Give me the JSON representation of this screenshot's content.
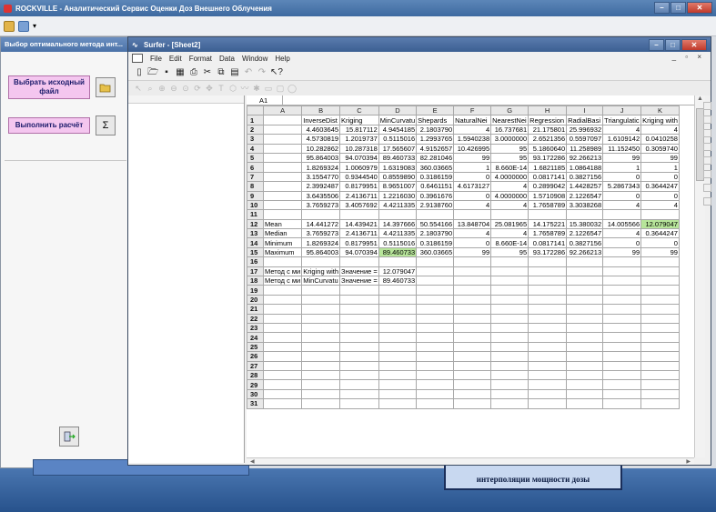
{
  "app": {
    "title": "ROCKVILLE - Аналитический Сервис Оценки Доз Внешнего Облучения"
  },
  "left_panel": {
    "title": "Выбор оптимального метода инт...",
    "select_file_label": "Выбрать исходный файл",
    "run_calc_label": "Выполнить расчёт",
    "run_calc_icon_glyph": "Σ",
    "icons": [
      "folder-open-icon",
      "sigma-icon",
      "exit-icon"
    ]
  },
  "surfer": {
    "title": "Surfer - [Sheet2]",
    "menu": [
      "File",
      "Edit",
      "Format",
      "Data",
      "Window",
      "Help"
    ],
    "cell_ref": "A1"
  },
  "bottom": {
    "dose_card_text": "интерполяции мощности дозы"
  },
  "sheet": {
    "columns": [
      "A",
      "B",
      "C",
      "D",
      "E",
      "F",
      "G",
      "H",
      "I",
      "J",
      "K"
    ],
    "rows": [
      [
        "1",
        "",
        "InverseDist",
        "Kriging",
        "MinCurvatu",
        "Shepards",
        "NaturalNei",
        "NearestNei",
        "Regression",
        "RadialBasi",
        "Triangulatic",
        "Kriging with"
      ],
      [
        "2",
        "",
        "4.4603645",
        "15.817112",
        "4.9454185",
        "2.1803790",
        "4",
        "16.737681",
        "21.175801",
        "25.996932",
        "4",
        "4"
      ],
      [
        "3",
        "",
        "4.5730819",
        "1.2019737",
        "0.5115016",
        "1.2993765",
        "1.5940238",
        "3.0000000",
        "2.6521356",
        "0.5597097",
        "1.6109142",
        "0.0410258"
      ],
      [
        "4",
        "",
        "10.282862",
        "10.287318",
        "17.565607",
        "4.9152657",
        "10.426995",
        "95",
        "5.1860640",
        "11.258989",
        "11.152450",
        "0.3059740"
      ],
      [
        "5",
        "",
        "95.864003",
        "94.070394",
        "89.460733",
        "82.281046",
        "99",
        "95",
        "93.172286",
        "92.266213",
        "99",
        "99"
      ],
      [
        "6",
        "",
        "1.8269324",
        "1.0060979",
        "1.6319083",
        "360.03665",
        "1",
        "8.660E-14",
        "1.6821185",
        "1.0864188",
        "1",
        "1"
      ],
      [
        "7",
        "",
        "3.1554770",
        "0.9344540",
        "0.8559890",
        "0.3186159",
        "0",
        "4.0000000",
        "0.0817141",
        "0.3827156",
        "0",
        "0"
      ],
      [
        "8",
        "",
        "2.3992487",
        "0.8179951",
        "8.9651007",
        "0.6461151",
        "4.6173127",
        "4",
        "0.2899042",
        "1.4428257",
        "5.2867343",
        "0.3644247"
      ],
      [
        "9",
        "",
        "3.6435506",
        "2.4136711",
        "1.2216030",
        "0.3961676",
        "0",
        "4.0000000",
        "1.5710908",
        "2.1226547",
        "0",
        "0"
      ],
      [
        "10",
        "",
        "3.7659273",
        "3.4057692",
        "4.4211335",
        "2.9138760",
        "4",
        "4",
        "1.7658789",
        "3.3038268",
        "4",
        "4"
      ],
      [
        "11",
        "",
        "",
        "",
        "",
        "",
        "",
        "",
        "",
        "",
        "",
        ""
      ],
      [
        "12",
        "Mean",
        "14.441272",
        "14.439421",
        "14.397666",
        "50.554166",
        "13.848704",
        "25.081965",
        "14.175221",
        "15.380032",
        "14.005566",
        "12.079047"
      ],
      [
        "13",
        "Median",
        "3.7659273",
        "2.4136711",
        "4.4211335",
        "2.1803790",
        "4",
        "4",
        "1.7658789",
        "2.1226547",
        "4",
        "0.3644247"
      ],
      [
        "14",
        "Minimum",
        "1.8269324",
        "0.8179951",
        "0.5115016",
        "0.3186159",
        "0",
        "8.660E-14",
        "0.0817141",
        "0.3827156",
        "0",
        "0"
      ],
      [
        "15",
        "Maximum",
        "95.864003",
        "94.070394",
        "89.460733",
        "360.03665",
        "99",
        "95",
        "93.172286",
        "92.266213",
        "99",
        "99"
      ],
      [
        "16",
        "",
        "",
        "",
        "",
        "",
        "",
        "",
        "",
        "",
        "",
        ""
      ],
      [
        "17",
        "Метод с ми",
        "Kriging with",
        "Значение =",
        "12.079047",
        "",
        "",
        "",
        "",
        "",
        "",
        ""
      ],
      [
        "18",
        "Метод с ми",
        "MinCurvatu",
        "Значение =",
        "89.460733",
        "",
        "",
        "",
        "",
        "",
        "",
        ""
      ],
      [
        "19",
        "",
        "",
        "",
        "",
        "",
        "",
        "",
        "",
        "",
        "",
        ""
      ],
      [
        "20",
        "",
        "",
        "",
        "",
        "",
        "",
        "",
        "",
        "",
        "",
        ""
      ],
      [
        "21",
        "",
        "",
        "",
        "",
        "",
        "",
        "",
        "",
        "",
        "",
        ""
      ],
      [
        "22",
        "",
        "",
        "",
        "",
        "",
        "",
        "",
        "",
        "",
        "",
        ""
      ],
      [
        "23",
        "",
        "",
        "",
        "",
        "",
        "",
        "",
        "",
        "",
        "",
        ""
      ],
      [
        "24",
        "",
        "",
        "",
        "",
        "",
        "",
        "",
        "",
        "",
        "",
        ""
      ],
      [
        "25",
        "",
        "",
        "",
        "",
        "",
        "",
        "",
        "",
        "",
        "",
        ""
      ],
      [
        "26",
        "",
        "",
        "",
        "",
        "",
        "",
        "",
        "",
        "",
        "",
        ""
      ],
      [
        "27",
        "",
        "",
        "",
        "",
        "",
        "",
        "",
        "",
        "",
        "",
        ""
      ],
      [
        "28",
        "",
        "",
        "",
        "",
        "",
        "",
        "",
        "",
        "",
        "",
        ""
      ],
      [
        "29",
        "",
        "",
        "",
        "",
        "",
        "",
        "",
        "",
        "",
        "",
        ""
      ],
      [
        "30",
        "",
        "",
        "",
        "",
        "",
        "",
        "",
        "",
        "",
        "",
        ""
      ],
      [
        "31",
        "",
        "",
        "",
        "",
        "",
        "",
        "",
        "",
        "",
        "",
        ""
      ]
    ],
    "highlighted_cells": [
      {
        "row": 12,
        "col": "K",
        "color": "#b7e59a"
      },
      {
        "row": 15,
        "col": "D",
        "color": "#b7e59a"
      }
    ]
  }
}
